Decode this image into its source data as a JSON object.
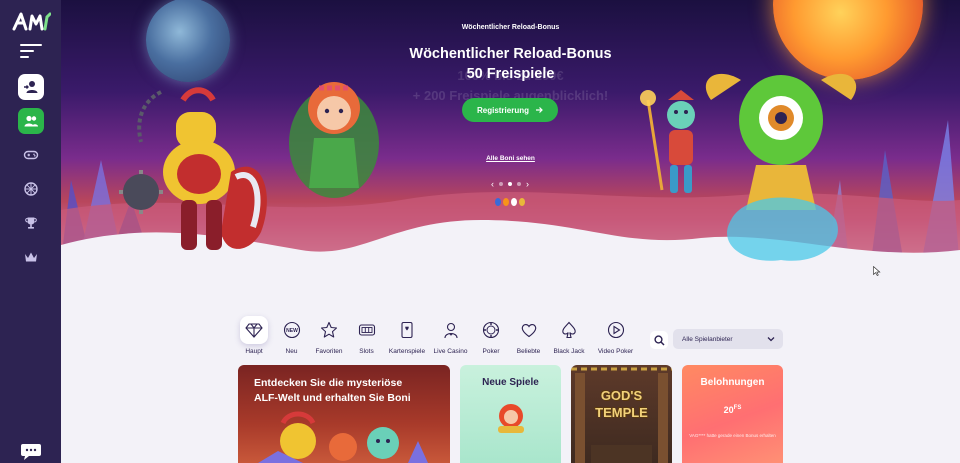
{
  "sidebar": {
    "logo_icon": "alf-logo-icon",
    "menu_icon": "hamburger-icon",
    "items": [
      {
        "name": "login",
        "icon": "user-login-icon"
      },
      {
        "name": "register",
        "icon": "add-users-icon"
      },
      {
        "name": "games",
        "icon": "gamepad-icon"
      },
      {
        "name": "wheel",
        "icon": "wheel-icon"
      },
      {
        "name": "tournaments",
        "icon": "trophy-icon"
      },
      {
        "name": "vip",
        "icon": "crown-icon"
      }
    ],
    "chat_icon": "chat-icon"
  },
  "hero": {
    "kicker": "Wöchentlicher Reload-Bonus",
    "title_line1": "Wöchentlicher Reload-Bonus",
    "title_line2": "50 Freispiele",
    "ghost_line1": "100% bis zu 200€",
    "ghost_line2": "+ 200 Freispiele augenblicklich!",
    "register_label": "Registrierung",
    "all_bonuses_label": "Alle Boni sehen",
    "slider_dots": 3,
    "active_dot": 2,
    "payment_icons": [
      "litecoin-icon",
      "bitcoin-icon",
      "ripple-icon",
      "dogecoin-icon"
    ]
  },
  "categories": [
    {
      "label": "Haupt",
      "icon": "diamond-icon",
      "active": true
    },
    {
      "label": "Neu",
      "icon": "new-badge-icon",
      "active": false
    },
    {
      "label": "Favoriten",
      "icon": "star-icon",
      "active": false
    },
    {
      "label": "Slots",
      "icon": "slot-machine-icon",
      "active": false
    },
    {
      "label": "Kartenspiele",
      "icon": "playing-card-icon",
      "active": false
    },
    {
      "label": "Live Casino",
      "icon": "dealer-icon",
      "active": false
    },
    {
      "label": "Poker",
      "icon": "poker-chip-icon",
      "active": false
    },
    {
      "label": "Beliebte",
      "icon": "heart-icon",
      "active": false
    },
    {
      "label": "Black Jack",
      "icon": "spade-icon",
      "active": false
    },
    {
      "label": "Video Poker",
      "icon": "play-icon",
      "active": false
    }
  ],
  "provider_select": {
    "value": "Alle Spielanbieter"
  },
  "cards": {
    "promo_line1": "Entdecken Sie die mysteriöse",
    "promo_line2": "ALF-Welt und erhalten Sie Boni",
    "new_games_title": "Neue Spiele",
    "temple_line1": "GOD'S",
    "temple_line2": "TEMPLE",
    "rewards_title": "Belohnungen",
    "rewards_amount": "20",
    "rewards_unit": "FS",
    "rewards_sub": "VAG**** hatte gerade einen Bonus erhalten"
  },
  "colors": {
    "sidebar": "#2d2352",
    "accent_green": "#2bb54a",
    "rewards_card": "#ff7070",
    "new_games_card": "#b5ebd3"
  }
}
